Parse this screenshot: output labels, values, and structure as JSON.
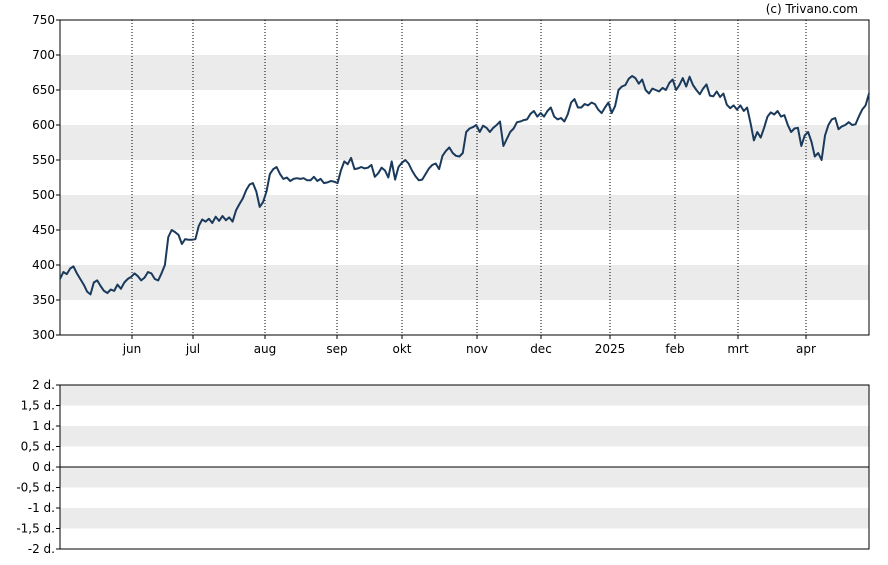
{
  "copyright": "(c) Trivano.com",
  "chart_data": [
    {
      "type": "line",
      "title": "",
      "xlabel": "",
      "ylabel": "",
      "ylim": [
        300,
        750
      ],
      "y_ticks": [
        "300",
        "350",
        "400",
        "450",
        "500",
        "550",
        "600",
        "650",
        "700",
        "750"
      ],
      "x_tick_labels": [
        "jun",
        "jul",
        "aug",
        "sep",
        "okt",
        "nov",
        "dec",
        "2025",
        "feb",
        "mrt",
        "apr"
      ],
      "grid": "alternating horizontal bands, dotted vertical lines at month ticks",
      "line_color": "#1a3a5c",
      "band_color": "#ebebeb",
      "series": [
        {
          "values": [
            380,
            390,
            387,
            395,
            398,
            388,
            380,
            372,
            362,
            358,
            375,
            378,
            370,
            363,
            360,
            365,
            363,
            372,
            366,
            375,
            380,
            383,
            388,
            384,
            378,
            382,
            390,
            388,
            380,
            378,
            388,
            400,
            440,
            450,
            447,
            443,
            430,
            437,
            436,
            436,
            437,
            456,
            465,
            462,
            466,
            460,
            469,
            463,
            470,
            464,
            468,
            462,
            478,
            487,
            495,
            507,
            515,
            517,
            505,
            483,
            490,
            505,
            530,
            537,
            540,
            530,
            523,
            525,
            520,
            523,
            524,
            523,
            524,
            521,
            521,
            526,
            520,
            523,
            517,
            518,
            520,
            519,
            517,
            535,
            548,
            544,
            553,
            537,
            538,
            540,
            538,
            539,
            543,
            526,
            531,
            539,
            535,
            525,
            548,
            522,
            540,
            546,
            550,
            545,
            535,
            527,
            521,
            522,
            530,
            538,
            543,
            545,
            537,
            556,
            563,
            568,
            560,
            556,
            555,
            560,
            590,
            595,
            597,
            600,
            590,
            599,
            596,
            590,
            596,
            600,
            605,
            570,
            580,
            590,
            595,
            604,
            605,
            607,
            608,
            616,
            620,
            612,
            617,
            612,
            620,
            625,
            612,
            608,
            610,
            605,
            615,
            632,
            637,
            625,
            625,
            630,
            628,
            632,
            630,
            622,
            617,
            625,
            632,
            617,
            627,
            650,
            655,
            657,
            666,
            670,
            667,
            659,
            665,
            650,
            645,
            652,
            650,
            648,
            653,
            650,
            660,
            665,
            650,
            657,
            667,
            655,
            669,
            657,
            650,
            644,
            652,
            658,
            642,
            641,
            648,
            640,
            645,
            629,
            624,
            628,
            622,
            628,
            620,
            625,
            603,
            578,
            590,
            582,
            596,
            612,
            618,
            615,
            620,
            612,
            614,
            600,
            590,
            595,
            596,
            570,
            585,
            590,
            576,
            555,
            560,
            550,
            585,
            600,
            608,
            610,
            594,
            598,
            600,
            604,
            600,
            601,
            612,
            622,
            628,
            645
          ]
        }
      ]
    },
    {
      "type": "line",
      "title": "",
      "ylim": [
        -2,
        2
      ],
      "y_ticks": [
        "2 d.",
        "1,5 d.",
        "1 d.",
        "0,5 d.",
        "0 d.",
        "-0,5 d.",
        "-1 d.",
        "-1,5 d.",
        "-2 d."
      ],
      "grid": "alternating horizontal bands",
      "series": []
    }
  ]
}
